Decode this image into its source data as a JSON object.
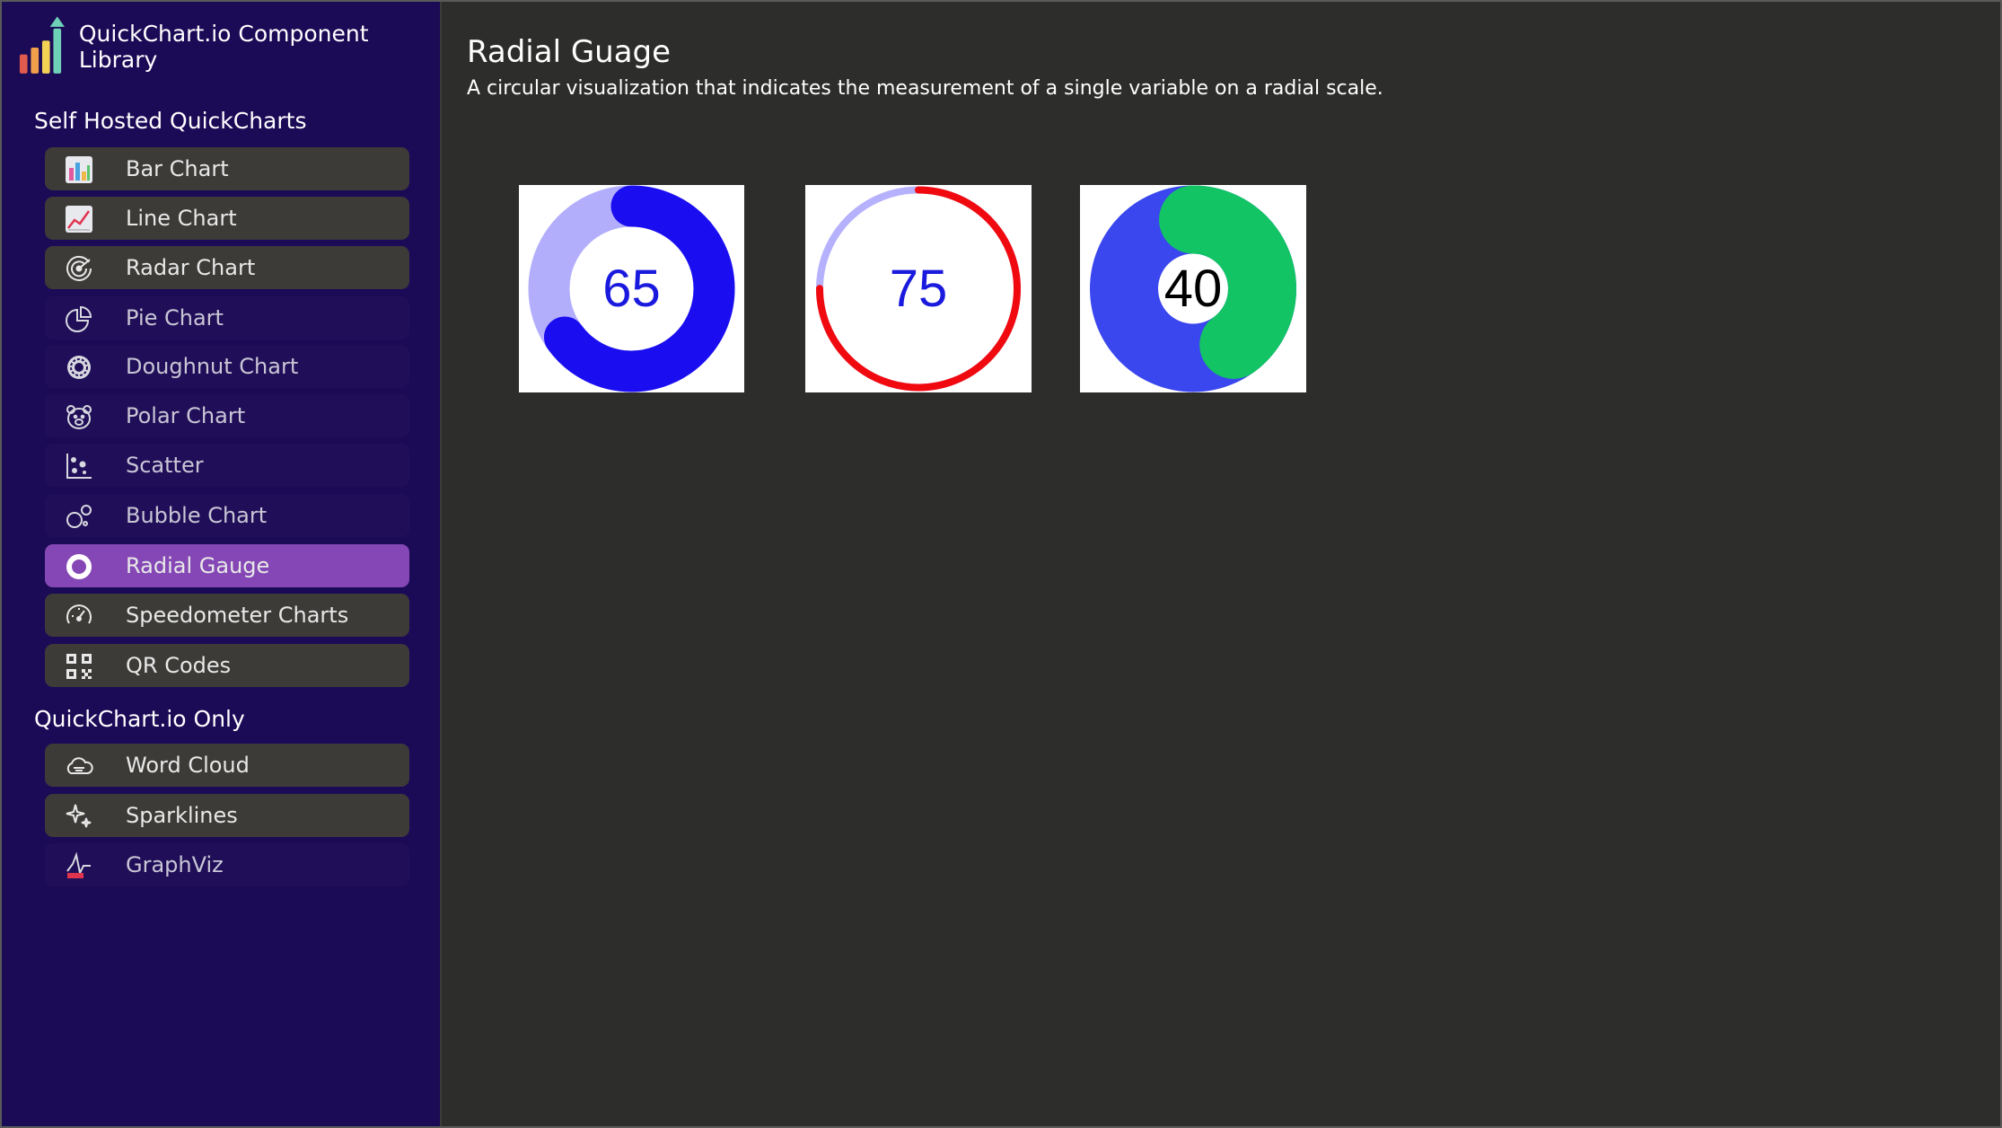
{
  "brand": {
    "title": "QuickChart.io Component Library"
  },
  "sections": {
    "self_hosted": "Self Hosted QuickCharts",
    "qc_only": "QuickChart.io Only"
  },
  "nav": [
    {
      "label": "Bar Chart",
      "icon": "bar-chart-icon"
    },
    {
      "label": "Line Chart",
      "icon": "line-chart-icon"
    },
    {
      "label": "Radar Chart",
      "icon": "radar-icon"
    },
    {
      "label": "Pie Chart",
      "icon": "pie-chart-icon"
    },
    {
      "label": "Doughnut Chart",
      "icon": "doughnut-icon"
    },
    {
      "label": "Polar Chart",
      "icon": "polar-bear-icon"
    },
    {
      "label": "Scatter",
      "icon": "scatter-icon"
    },
    {
      "label": "Bubble Chart",
      "icon": "bubble-icon"
    },
    {
      "label": "Radial Gauge",
      "icon": "ring-icon"
    },
    {
      "label": "Speedometer Charts",
      "icon": "speedometer-icon"
    },
    {
      "label": "QR Codes",
      "icon": "qr-code-icon"
    },
    {
      "label": "Word Cloud",
      "icon": "cloud-icon"
    },
    {
      "label": "Sparklines",
      "icon": "sparkle-icon"
    },
    {
      "label": "GraphViz",
      "icon": "graph-icon"
    }
  ],
  "active_nav": "Radial Gauge",
  "main": {
    "title": "Radial Guage",
    "subtitle": "A circular visualization that indicates the measurement of a single variable on a radial scale."
  },
  "gauges": [
    {
      "value": "65",
      "fraction": 0.65,
      "fill_color": "#1a0ef0",
      "track_color": "#b3aefc",
      "text_color": "#1a1adf"
    },
    {
      "value": "75",
      "fraction": 0.75,
      "fill_color": "#f00a10",
      "track_color": "#b6b1fc",
      "text_color": "#1a1adf"
    },
    {
      "value": "40",
      "fraction": 0.4,
      "fill_color": "#12c464",
      "track_color": "#3a46ee",
      "text_color": "#000000"
    }
  ],
  "colors": {
    "sidebar_bg": "#1b0a56",
    "main_bg": "#2d2d2b",
    "active_item": "#8447b5",
    "item_bg": "#3c3b38"
  }
}
